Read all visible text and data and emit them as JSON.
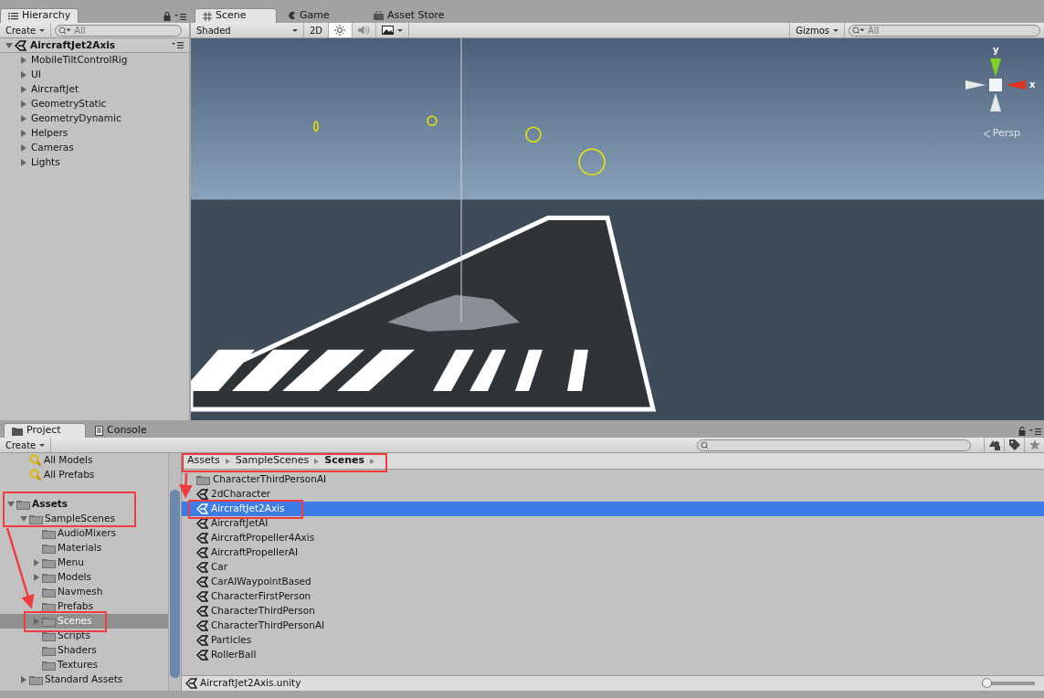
{
  "hierarchy": {
    "tab": "Hierarchy",
    "create": "Create",
    "search_placeholder": "All",
    "scene": {
      "label": "AircraftJet2Axis",
      "kind": "branch",
      "expanded": true
    },
    "items": [
      {
        "label": "MobileTiltControlRig",
        "kind": "branch",
        "expanded": false
      },
      {
        "label": "UI",
        "kind": "branch",
        "expanded": false
      },
      {
        "label": "AircraftJet",
        "kind": "branch",
        "expanded": false
      },
      {
        "label": "GeometryStatic",
        "kind": "branch",
        "expanded": false
      },
      {
        "label": "GeometryDynamic",
        "kind": "branch",
        "expanded": false
      },
      {
        "label": "Helpers",
        "kind": "branch",
        "expanded": false
      },
      {
        "label": "Cameras",
        "kind": "branch",
        "expanded": false
      },
      {
        "label": "Lights",
        "kind": "branch",
        "expanded": false
      }
    ]
  },
  "scene_tabs": [
    {
      "label": "Scene",
      "kind": "scene",
      "selected": true
    },
    {
      "label": "Game",
      "kind": "game",
      "selected": false
    },
    {
      "label": "Asset Store",
      "kind": "store",
      "selected": false
    }
  ],
  "scene_toolbar": {
    "shading": "Shaded",
    "mode_2d": "2D",
    "lighting_on": true,
    "audio_on": false,
    "gizmos": "Gizmos",
    "search_placeholder": "All"
  },
  "scene_view": {
    "axis_labels": [
      "y",
      "x"
    ],
    "projection": "Persp"
  },
  "project_tabs": [
    {
      "label": "Project",
      "kind": "project",
      "selected": true
    },
    {
      "label": "Console",
      "kind": "console",
      "selected": false
    }
  ],
  "project": {
    "create": "Create",
    "favorites": [
      {
        "label": "All Models"
      },
      {
        "label": "All Prefabs"
      }
    ],
    "tree": [
      {
        "label": "Assets",
        "kind": "branch",
        "expanded": true,
        "selected": false,
        "children": [
          {
            "label": "SampleScenes",
            "kind": "branch",
            "expanded": true,
            "selected": false,
            "children": [
              {
                "label": "AudioMixers",
                "kind": "leaf",
                "selected": false
              },
              {
                "label": "Materials",
                "kind": "leaf",
                "selected": false
              },
              {
                "label": "Menu",
                "kind": "branch",
                "expanded": false,
                "selected": false
              },
              {
                "label": "Models",
                "kind": "branch",
                "expanded": false,
                "selected": false
              },
              {
                "label": "Navmesh",
                "kind": "leaf",
                "selected": false
              },
              {
                "label": "Prefabs",
                "kind": "leaf",
                "selected": false
              },
              {
                "label": "Scenes",
                "kind": "branch",
                "expanded": false,
                "selected": true
              },
              {
                "label": "Scripts",
                "kind": "leaf",
                "selected": false
              },
              {
                "label": "Shaders",
                "kind": "leaf",
                "selected": false
              },
              {
                "label": "Textures",
                "kind": "leaf",
                "selected": false
              }
            ]
          },
          {
            "label": "Standard Assets",
            "kind": "branch",
            "expanded": false,
            "selected": false
          }
        ]
      }
    ],
    "breadcrumb": [
      "Assets",
      "SampleScenes",
      "Scenes"
    ],
    "files": [
      {
        "label": "CharacterThirdPersonAI",
        "kind": "folder",
        "selected": false
      },
      {
        "label": "2dCharacter",
        "kind": "scene",
        "selected": false
      },
      {
        "label": "AircraftJet2Axis",
        "kind": "scene",
        "selected": true
      },
      {
        "label": "AircraftJetAI",
        "kind": "scene",
        "selected": false
      },
      {
        "label": "AircraftPropeller4Axis",
        "kind": "scene",
        "selected": false
      },
      {
        "label": "AircraftPropellerAI",
        "kind": "scene",
        "selected": false
      },
      {
        "label": "Car",
        "kind": "scene",
        "selected": false
      },
      {
        "label": "CarAIWaypointBased",
        "kind": "scene",
        "selected": false
      },
      {
        "label": "CharacterFirstPerson",
        "kind": "scene",
        "selected": false
      },
      {
        "label": "CharacterThirdPerson",
        "kind": "scene",
        "selected": false
      },
      {
        "label": "CharacterThirdPersonAI",
        "kind": "scene",
        "selected": false
      },
      {
        "label": "Particles",
        "kind": "scene",
        "selected": false
      },
      {
        "label": "RollerBall",
        "kind": "scene",
        "selected": false
      }
    ],
    "status_file": "AircraftJet2Axis.unity",
    "icon_size": {
      "level": 0
    }
  }
}
